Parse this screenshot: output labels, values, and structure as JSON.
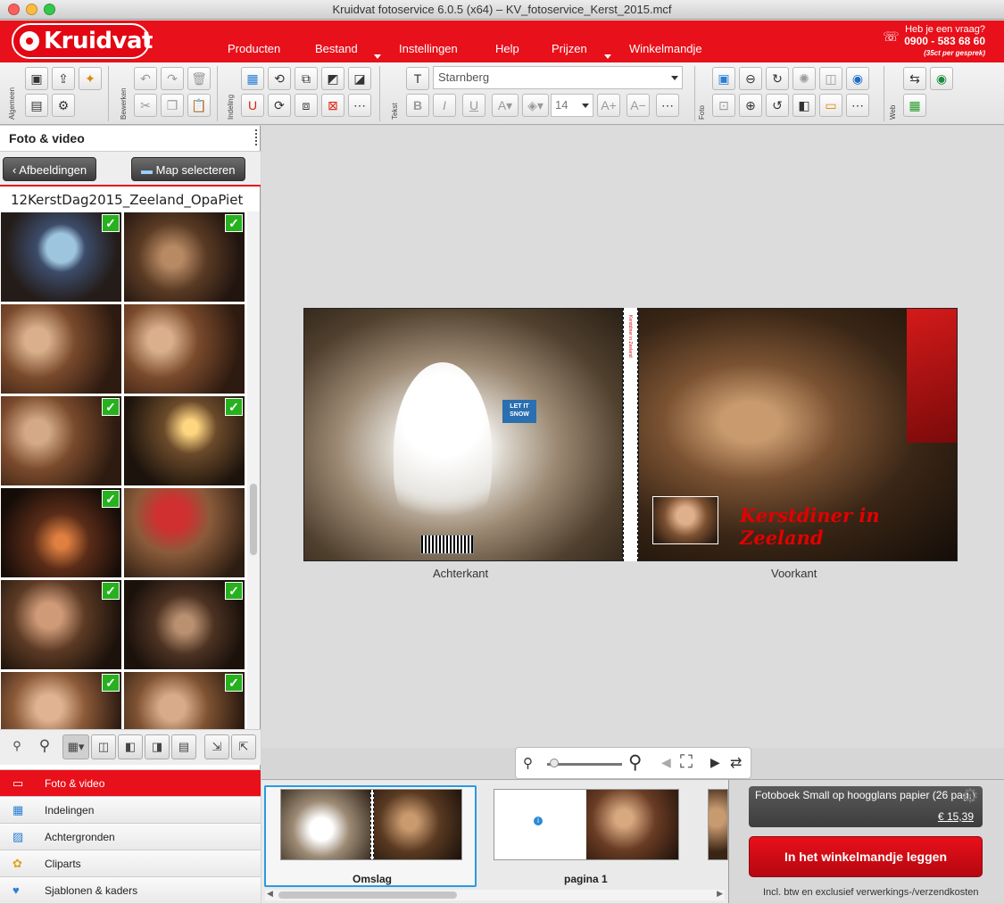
{
  "window": {
    "title": "Kruidvat fotoservice 6.0.5 (x64) – KV_fotoservice_Kerst_2015.mcf"
  },
  "header": {
    "logo": "Kruidvat",
    "menu": [
      {
        "label": "Producten"
      },
      {
        "label": "Bestand"
      },
      {
        "label": "Instellingen"
      },
      {
        "label": "Help"
      },
      {
        "label": "Prijzen"
      },
      {
        "label": "Winkelmandje"
      }
    ],
    "contact": {
      "question": "Heb je een vraag?",
      "phone": "0900 - 583 68 60",
      "cost": "(35ct per gesprek)"
    }
  },
  "toolbar": {
    "groups": [
      "Algemeen",
      "Bewerken",
      "Indeling",
      "Tekst",
      "Foto",
      "Web"
    ],
    "font": "Starnberg",
    "font_size": "14",
    "bold": "B",
    "italic": "I",
    "underline": "U"
  },
  "left_panel": {
    "title": "Foto & video",
    "back_button": "Afbeeldingen",
    "folder_button": "Map selecteren",
    "folder_name": "12KerstDag2015_Zeeland_OpaPiet",
    "thumbnails": [
      {
        "checked": true
      },
      {
        "checked": true
      },
      {
        "checked": false
      },
      {
        "checked": false
      },
      {
        "checked": true
      },
      {
        "checked": true
      },
      {
        "checked": true
      },
      {
        "checked": false
      },
      {
        "checked": true
      },
      {
        "checked": true
      },
      {
        "checked": true
      },
      {
        "checked": true
      }
    ],
    "nav": [
      {
        "label": "Foto & video",
        "icon": "photo-icon",
        "active": true
      },
      {
        "label": "Indelingen",
        "icon": "layout-icon",
        "active": false
      },
      {
        "label": "Achtergronden",
        "icon": "background-icon",
        "active": false
      },
      {
        "label": "Cliparts",
        "icon": "clipart-icon",
        "active": false
      },
      {
        "label": "Sjablonen & kaders",
        "icon": "frames-icon",
        "active": false
      }
    ]
  },
  "canvas": {
    "back_label": "Achterkant",
    "front_label": "Voorkant",
    "cover_title": "Kerstdiner in Zeeland",
    "snow_sign": "LET IT SNOW",
    "zoom_fraction": 0.05
  },
  "strip": {
    "pages": [
      {
        "label": "Omslag",
        "selected": true
      },
      {
        "label": "pagina 1",
        "selected": false
      }
    ]
  },
  "order": {
    "product": "Fotoboek Small op hoogglans papier  (26 pag.)",
    "price": "€ 15,39",
    "cart_button": "In het winkelmandje leggen",
    "note": "Incl. btw en exclusief verwerkings-/verzendkosten"
  },
  "colors": {
    "brand_red": "#e8101a",
    "check_green": "#27b11f",
    "selection_blue": "#2a9be0"
  }
}
